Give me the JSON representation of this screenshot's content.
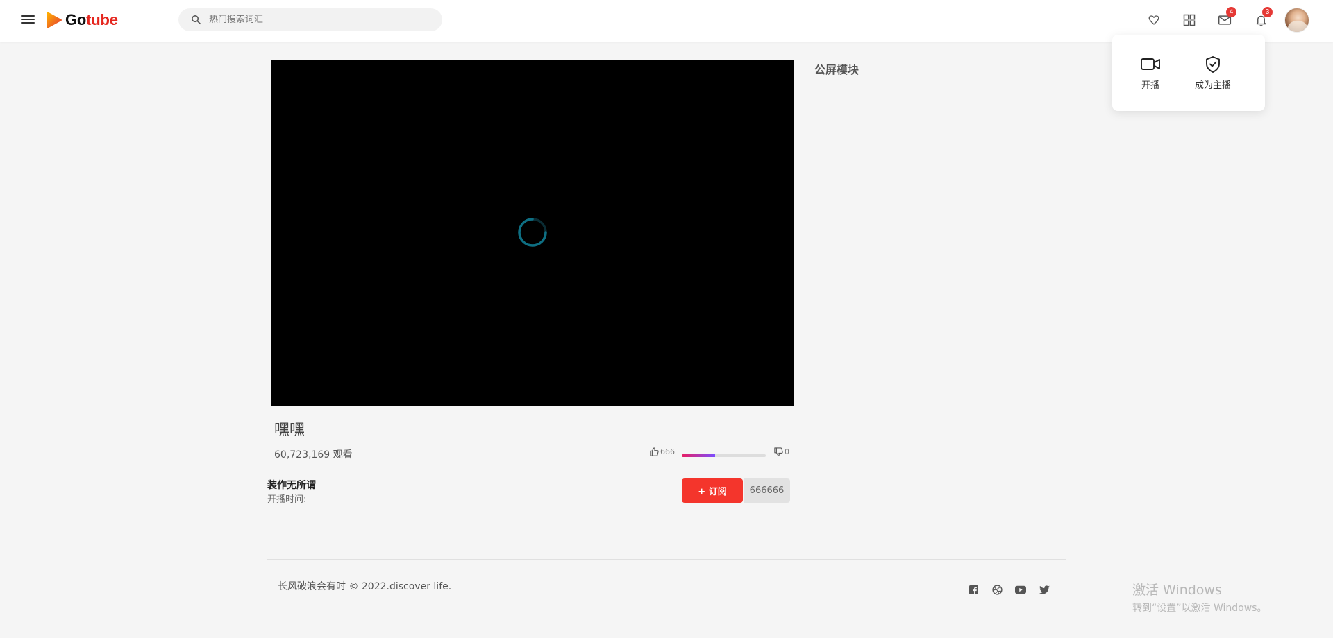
{
  "header": {
    "logo_go": "Go",
    "logo_tube": "tube",
    "search_placeholder": "热门搜索词汇",
    "mail_badge": "4",
    "notification_badge": "3"
  },
  "dropdown": {
    "items": [
      {
        "label": "开播",
        "icon": "video-camera-icon"
      },
      {
        "label": "成为主播",
        "icon": "shield-check-icon"
      }
    ]
  },
  "video": {
    "title": "嘿嘿",
    "views": "60,723,169 观看",
    "likes": "666",
    "dislikes": "0",
    "like_ratio": 0.4
  },
  "channel": {
    "name": "装作无所谓",
    "start_time_label": "开播时间:",
    "subscribe_label": "+ 订阅",
    "subscriber_count": "666666"
  },
  "side_panel": {
    "title": "公屏模块"
  },
  "footer": {
    "copyright": "长风破浪会有时 © 2022.discover life.",
    "socials": [
      "facebook-icon",
      "dribbble-icon",
      "youtube-icon",
      "twitter-icon"
    ]
  },
  "watermark": {
    "line1": "激活 Windows",
    "line2": "转到“设置”以激活 Windows。"
  },
  "colors": {
    "accent_red": "#f4352c",
    "badge_red": "#e53935",
    "spinner": "#0e6f83"
  }
}
